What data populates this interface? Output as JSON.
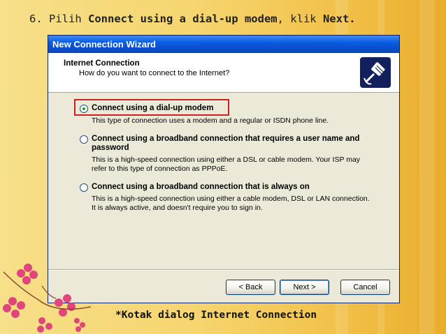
{
  "slide": {
    "step_number": "6.",
    "step_text_pre": "Pilih ",
    "step_text_bold1": "Connect using a dial-up modem",
    "step_text_mid": ", klik ",
    "step_text_bold2": "Next.",
    "caption": "*Kotak dialog Internet Connection"
  },
  "dialog": {
    "title": "New Connection Wizard",
    "header_title": "Internet Connection",
    "header_subtitle": "How do you want to connect to the Internet?",
    "icon": "network-cable-icon",
    "options": [
      {
        "label": "Connect using a dial-up modem",
        "description": "This type of connection uses a modem and a regular or ISDN phone line.",
        "checked": true
      },
      {
        "label": "Connect using a broadband connection that requires a user name and password",
        "description": "This is a high-speed connection using either a DSL or cable modem. Your ISP may refer to this type of connection as PPPoE.",
        "checked": false
      },
      {
        "label": "Connect using a broadband connection that is always on",
        "description": "This is a high-speed connection using either a cable modem, DSL or LAN connection. It is always active, and doesn't require you to sign in.",
        "checked": false
      }
    ],
    "buttons": {
      "back": "< Back",
      "next": "Next >",
      "cancel": "Cancel"
    }
  },
  "colors": {
    "highlight_border": "#cc2121",
    "titlebar": "#0a4fd0",
    "dialog_bg": "#ece9d8"
  }
}
